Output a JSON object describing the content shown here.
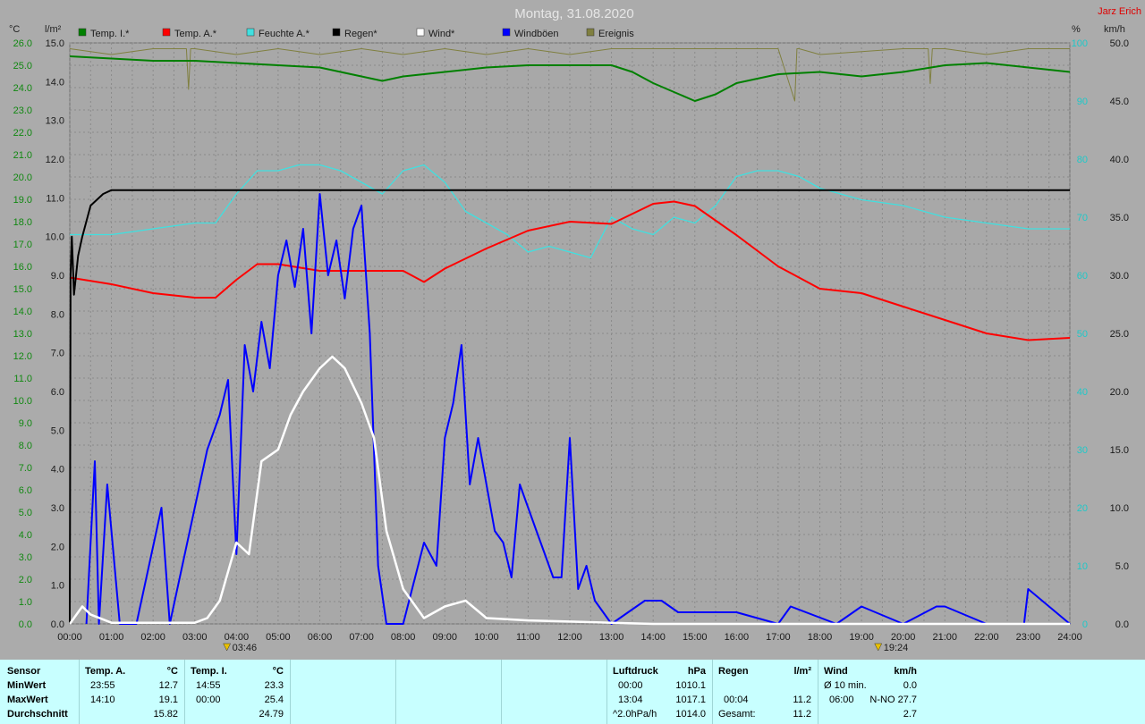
{
  "header": {
    "title": "Montag, 31.08.2020",
    "author": "Jarz Erich"
  },
  "units": {
    "left_temp": "°C",
    "left_rain": "l/m²",
    "right_humidity": "%",
    "right_wind": "km/h"
  },
  "legend": [
    {
      "label": "Temp. I.*",
      "color": "#008000"
    },
    {
      "label": "Temp. A.*",
      "color": "#ff0000"
    },
    {
      "label": "Feuchte A.*",
      "color": "#40e0e0"
    },
    {
      "label": "Regen*",
      "color": "#000000"
    },
    {
      "label": "Wind*",
      "color": "#ffffff"
    },
    {
      "label": "Windböen",
      "color": "#0000ff"
    },
    {
      "label": "Ereignis",
      "color": "#808040"
    }
  ],
  "markers": [
    {
      "label": "03:46",
      "hour": 3.77
    },
    {
      "label": "19:24",
      "hour": 19.4
    }
  ],
  "chart_data": {
    "type": "line",
    "x_unit": "hour of day",
    "xlim": [
      0,
      24
    ],
    "x_tick_labels": [
      "00:00",
      "01:00",
      "02:00",
      "03:00",
      "04:00",
      "05:00",
      "06:00",
      "07:00",
      "08:00",
      "09:00",
      "10:00",
      "11:00",
      "12:00",
      "13:00",
      "14:00",
      "15:00",
      "16:00",
      "17:00",
      "18:00",
      "19:00",
      "20:00",
      "21:00",
      "22:00",
      "23:00",
      "24:00"
    ],
    "axes": {
      "temp": {
        "range": [
          0,
          26
        ],
        "ticks": [
          "26.0",
          "25.0",
          "24.0",
          "23.0",
          "22.0",
          "21.0",
          "20.0",
          "19.0",
          "18.0",
          "17.0",
          "16.0",
          "15.0",
          "14.0",
          "13.0",
          "12.0",
          "11.0",
          "10.0",
          "9.0",
          "8.0",
          "7.0",
          "6.0",
          "5.0",
          "4.0",
          "3.0",
          "2.0",
          "1.0",
          "0.0"
        ]
      },
      "rain": {
        "range": [
          0,
          15
        ],
        "ticks": [
          "15.0",
          "14.0",
          "13.0",
          "12.0",
          "11.0",
          "10.0",
          "9.0",
          "8.0",
          "7.0",
          "6.0",
          "5.0",
          "4.0",
          "3.0",
          "2.0",
          "1.0",
          "0.0"
        ]
      },
      "humidity": {
        "range": [
          0,
          100
        ],
        "ticks": [
          "100",
          "90",
          "80",
          "70",
          "60",
          "50",
          "40",
          "30",
          "20",
          "10",
          "0"
        ]
      },
      "wind": {
        "range": [
          0,
          50
        ],
        "ticks": [
          "50.0",
          "45.0",
          "40.0",
          "35.0",
          "30.0",
          "25.0",
          "20.0",
          "15.0",
          "10.0",
          "5.0",
          "0.0"
        ]
      }
    },
    "series": [
      {
        "name": "Temp. I.*",
        "axis": "temp",
        "color": "#008000",
        "x": [
          0,
          1,
          2,
          3,
          4,
          5,
          6,
          6.5,
          7,
          7.5,
          8,
          9,
          10,
          11,
          12,
          13,
          13.5,
          14,
          14.5,
          15,
          15.5,
          16,
          17,
          18,
          19,
          20,
          21,
          22,
          23,
          24
        ],
        "y": [
          25.4,
          25.3,
          25.2,
          25.2,
          25.1,
          25.0,
          24.9,
          24.7,
          24.5,
          24.3,
          24.5,
          24.7,
          24.9,
          25.0,
          25.0,
          25.0,
          24.7,
          24.2,
          23.8,
          23.4,
          23.7,
          24.2,
          24.6,
          24.7,
          24.5,
          24.7,
          25.0,
          25.1,
          24.9,
          24.7
        ]
      },
      {
        "name": "Temp. A.*",
        "axis": "temp",
        "color": "#ff0000",
        "x": [
          0,
          1,
          2,
          3,
          3.5,
          4,
          4.5,
          5,
          6,
          7,
          8,
          8.5,
          9,
          10,
          11,
          12,
          13,
          14,
          14.5,
          15,
          16,
          17,
          18,
          19,
          20,
          21,
          22,
          23,
          24
        ],
        "y": [
          15.5,
          15.2,
          14.8,
          14.6,
          14.6,
          15.4,
          16.1,
          16.1,
          15.8,
          15.8,
          15.8,
          15.3,
          15.9,
          16.8,
          17.6,
          18.0,
          17.9,
          18.8,
          18.9,
          18.7,
          17.4,
          16.0,
          15.0,
          14.8,
          14.2,
          13.6,
          13.0,
          12.7,
          12.8
        ]
      },
      {
        "name": "Feuchte A.*",
        "axis": "humidity",
        "color": "#40e0e0",
        "x": [
          0,
          1,
          2,
          3,
          3.5,
          4,
          4.5,
          5,
          5.5,
          6,
          6.5,
          7,
          7.5,
          8,
          8.5,
          9,
          9.5,
          10,
          10.5,
          11,
          11.5,
          12,
          12.5,
          13,
          13.5,
          14,
          14.5,
          15,
          15.5,
          16,
          16.5,
          17,
          17.5,
          18,
          19,
          20,
          21,
          22,
          23,
          24
        ],
        "y": [
          67,
          67,
          68,
          69,
          69,
          74,
          78,
          78,
          79,
          79,
          78,
          76,
          74,
          78,
          79,
          76,
          71,
          69,
          67,
          64,
          65,
          64,
          63,
          70,
          68,
          67,
          70,
          69,
          72,
          77,
          78,
          78,
          77,
          75,
          73,
          72,
          70,
          69,
          68,
          68
        ]
      },
      {
        "name": "Regen*",
        "axis": "rain",
        "color": "#000000",
        "x": [
          0,
          0.02,
          0.05,
          0.1,
          0.2,
          0.3,
          0.5,
          0.8,
          1.0,
          1.5,
          24
        ],
        "y": [
          0,
          9.0,
          10.0,
          8.5,
          9.5,
          10.0,
          10.8,
          11.1,
          11.2,
          11.2,
          11.2
        ]
      },
      {
        "name": "Wind*",
        "axis": "wind",
        "color": "#ffffff",
        "x": [
          0,
          0.3,
          0.5,
          1.0,
          2.0,
          3.0,
          3.3,
          3.6,
          4.0,
          4.3,
          4.6,
          5.0,
          5.3,
          5.6,
          6.0,
          6.3,
          6.6,
          7.0,
          7.3,
          7.6,
          8.0,
          8.5,
          9.0,
          9.5,
          10.0,
          11.0,
          12.0,
          13.0,
          14.0,
          24.0
        ],
        "y": [
          0,
          1.5,
          0.8,
          0.1,
          0.1,
          0.1,
          0.5,
          2.0,
          7.0,
          6.0,
          14.0,
          15.0,
          18.0,
          20.0,
          22.0,
          23.0,
          22.0,
          19.0,
          16.0,
          8.0,
          3.0,
          0.5,
          1.5,
          2.0,
          0.5,
          0.3,
          0.2,
          0.1,
          0,
          0
        ]
      },
      {
        "name": "Windböen",
        "axis": "wind",
        "color": "#0000ff",
        "x": [
          0.4,
          0.6,
          0.7,
          0.9,
          1.2,
          1.6,
          2.2,
          2.4,
          3.3,
          3.6,
          3.8,
          4.0,
          4.2,
          4.4,
          4.6,
          4.8,
          5.0,
          5.2,
          5.4,
          5.6,
          5.8,
          6.0,
          6.2,
          6.4,
          6.6,
          6.8,
          7.0,
          7.2,
          7.4,
          7.6,
          8.0,
          8.5,
          8.8,
          9.0,
          9.2,
          9.4,
          9.6,
          9.8,
          10.0,
          10.2,
          10.4,
          10.6,
          10.8,
          11.0,
          11.2,
          11.4,
          11.6,
          11.8,
          12.0,
          12.2,
          12.4,
          12.6,
          13.0,
          13.4,
          13.8,
          14.2,
          14.6,
          15.0,
          15.4,
          16.0,
          17.0,
          17.3,
          18.4,
          19.0,
          20.0,
          20.8,
          21.0,
          22.0,
          22.9,
          23.0,
          24.0
        ],
        "y": [
          0,
          14.0,
          0,
          12.0,
          0,
          0,
          10.0,
          0,
          15.0,
          18.0,
          21.0,
          6.0,
          24.0,
          20.0,
          26.0,
          22.0,
          30.0,
          33.0,
          29.0,
          34.0,
          25.0,
          37.0,
          30.0,
          33.0,
          28.0,
          34.0,
          36.0,
          25.0,
          5.0,
          0,
          0,
          7.0,
          5.0,
          16.0,
          19.0,
          24.0,
          12.0,
          16.0,
          12.0,
          8.0,
          7.0,
          4.0,
          12.0,
          10.0,
          8.0,
          6.0,
          4.0,
          4.0,
          16.0,
          3.0,
          5.0,
          2.0,
          0,
          1.0,
          2.0,
          2.0,
          1.0,
          1.0,
          1.0,
          1.0,
          0,
          1.5,
          0,
          1.5,
          0,
          1.5,
          1.5,
          0,
          0,
          3.0,
          0
        ]
      },
      {
        "name": "Ereignis",
        "axis": "humidity",
        "color": "#808040",
        "x": [
          0,
          1,
          2,
          2.8,
          2.85,
          2.9,
          3,
          4,
          5,
          6,
          7,
          8,
          9,
          10,
          11,
          12,
          13,
          17,
          17.4,
          17.45,
          17.5,
          18,
          20,
          20.6,
          20.65,
          20.7,
          21,
          22,
          23,
          24
        ],
        "y": [
          99,
          98,
          99,
          99,
          92,
          99,
          99,
          98,
          99,
          98,
          99,
          98,
          99,
          98,
          99,
          98,
          99,
          99,
          90,
          99,
          99,
          98,
          99,
          99,
          93,
          99,
          99,
          98,
          99,
          99
        ]
      }
    ]
  },
  "stats": {
    "sensor_col": {
      "header": "Sensor",
      "rows": [
        "MinWert",
        "MaxWert",
        "Durchschnitt"
      ]
    },
    "temp_a": {
      "header": "Temp. A.",
      "unit": "°C",
      "min_time": "23:55",
      "min": "12.7",
      "max_time": "14:10",
      "max": "19.1",
      "avg": "15.82"
    },
    "temp_i": {
      "header": "Temp. I.",
      "unit": "°C",
      "min_time": "14:55",
      "min": "23.3",
      "max_time": "00:00",
      "max": "25.4",
      "avg": "24.79"
    },
    "pressure": {
      "header": "Luftdruck",
      "unit": "hPa",
      "r1_time": "00:00",
      "r1": "1010.1",
      "r2_time": "13:04",
      "r2": "1017.1",
      "r3_time": "^2.0hPa/h",
      "r3": "1014.0"
    },
    "rain": {
      "header": "Regen",
      "unit": "l/m²",
      "r2_time": "00:04",
      "r2": "11.2",
      "r3_time": "Gesamt:",
      "r3": "11.2"
    },
    "wind": {
      "header": "Wind",
      "unit": "km/h",
      "r1_time": "Ø 10 min.",
      "r1": "0.0",
      "r2_time": "06:00",
      "r2": "N-NO 27.7",
      "r3": "2.7"
    }
  }
}
